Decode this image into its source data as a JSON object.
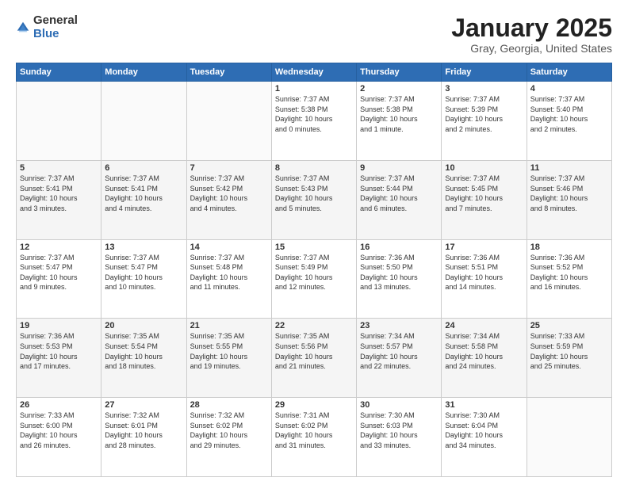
{
  "logo": {
    "general": "General",
    "blue": "Blue"
  },
  "header": {
    "month": "January 2025",
    "location": "Gray, Georgia, United States"
  },
  "weekdays": [
    "Sunday",
    "Monday",
    "Tuesday",
    "Wednesday",
    "Thursday",
    "Friday",
    "Saturday"
  ],
  "weeks": [
    [
      {
        "day": "",
        "info": ""
      },
      {
        "day": "",
        "info": ""
      },
      {
        "day": "",
        "info": ""
      },
      {
        "day": "1",
        "info": "Sunrise: 7:37 AM\nSunset: 5:38 PM\nDaylight: 10 hours\nand 0 minutes."
      },
      {
        "day": "2",
        "info": "Sunrise: 7:37 AM\nSunset: 5:38 PM\nDaylight: 10 hours\nand 1 minute."
      },
      {
        "day": "3",
        "info": "Sunrise: 7:37 AM\nSunset: 5:39 PM\nDaylight: 10 hours\nand 2 minutes."
      },
      {
        "day": "4",
        "info": "Sunrise: 7:37 AM\nSunset: 5:40 PM\nDaylight: 10 hours\nand 2 minutes."
      }
    ],
    [
      {
        "day": "5",
        "info": "Sunrise: 7:37 AM\nSunset: 5:41 PM\nDaylight: 10 hours\nand 3 minutes."
      },
      {
        "day": "6",
        "info": "Sunrise: 7:37 AM\nSunset: 5:41 PM\nDaylight: 10 hours\nand 4 minutes."
      },
      {
        "day": "7",
        "info": "Sunrise: 7:37 AM\nSunset: 5:42 PM\nDaylight: 10 hours\nand 4 minutes."
      },
      {
        "day": "8",
        "info": "Sunrise: 7:37 AM\nSunset: 5:43 PM\nDaylight: 10 hours\nand 5 minutes."
      },
      {
        "day": "9",
        "info": "Sunrise: 7:37 AM\nSunset: 5:44 PM\nDaylight: 10 hours\nand 6 minutes."
      },
      {
        "day": "10",
        "info": "Sunrise: 7:37 AM\nSunset: 5:45 PM\nDaylight: 10 hours\nand 7 minutes."
      },
      {
        "day": "11",
        "info": "Sunrise: 7:37 AM\nSunset: 5:46 PM\nDaylight: 10 hours\nand 8 minutes."
      }
    ],
    [
      {
        "day": "12",
        "info": "Sunrise: 7:37 AM\nSunset: 5:47 PM\nDaylight: 10 hours\nand 9 minutes."
      },
      {
        "day": "13",
        "info": "Sunrise: 7:37 AM\nSunset: 5:47 PM\nDaylight: 10 hours\nand 10 minutes."
      },
      {
        "day": "14",
        "info": "Sunrise: 7:37 AM\nSunset: 5:48 PM\nDaylight: 10 hours\nand 11 minutes."
      },
      {
        "day": "15",
        "info": "Sunrise: 7:37 AM\nSunset: 5:49 PM\nDaylight: 10 hours\nand 12 minutes."
      },
      {
        "day": "16",
        "info": "Sunrise: 7:36 AM\nSunset: 5:50 PM\nDaylight: 10 hours\nand 13 minutes."
      },
      {
        "day": "17",
        "info": "Sunrise: 7:36 AM\nSunset: 5:51 PM\nDaylight: 10 hours\nand 14 minutes."
      },
      {
        "day": "18",
        "info": "Sunrise: 7:36 AM\nSunset: 5:52 PM\nDaylight: 10 hours\nand 16 minutes."
      }
    ],
    [
      {
        "day": "19",
        "info": "Sunrise: 7:36 AM\nSunset: 5:53 PM\nDaylight: 10 hours\nand 17 minutes."
      },
      {
        "day": "20",
        "info": "Sunrise: 7:35 AM\nSunset: 5:54 PM\nDaylight: 10 hours\nand 18 minutes."
      },
      {
        "day": "21",
        "info": "Sunrise: 7:35 AM\nSunset: 5:55 PM\nDaylight: 10 hours\nand 19 minutes."
      },
      {
        "day": "22",
        "info": "Sunrise: 7:35 AM\nSunset: 5:56 PM\nDaylight: 10 hours\nand 21 minutes."
      },
      {
        "day": "23",
        "info": "Sunrise: 7:34 AM\nSunset: 5:57 PM\nDaylight: 10 hours\nand 22 minutes."
      },
      {
        "day": "24",
        "info": "Sunrise: 7:34 AM\nSunset: 5:58 PM\nDaylight: 10 hours\nand 24 minutes."
      },
      {
        "day": "25",
        "info": "Sunrise: 7:33 AM\nSunset: 5:59 PM\nDaylight: 10 hours\nand 25 minutes."
      }
    ],
    [
      {
        "day": "26",
        "info": "Sunrise: 7:33 AM\nSunset: 6:00 PM\nDaylight: 10 hours\nand 26 minutes."
      },
      {
        "day": "27",
        "info": "Sunrise: 7:32 AM\nSunset: 6:01 PM\nDaylight: 10 hours\nand 28 minutes."
      },
      {
        "day": "28",
        "info": "Sunrise: 7:32 AM\nSunset: 6:02 PM\nDaylight: 10 hours\nand 29 minutes."
      },
      {
        "day": "29",
        "info": "Sunrise: 7:31 AM\nSunset: 6:02 PM\nDaylight: 10 hours\nand 31 minutes."
      },
      {
        "day": "30",
        "info": "Sunrise: 7:30 AM\nSunset: 6:03 PM\nDaylight: 10 hours\nand 33 minutes."
      },
      {
        "day": "31",
        "info": "Sunrise: 7:30 AM\nSunset: 6:04 PM\nDaylight: 10 hours\nand 34 minutes."
      },
      {
        "day": "",
        "info": ""
      }
    ]
  ]
}
